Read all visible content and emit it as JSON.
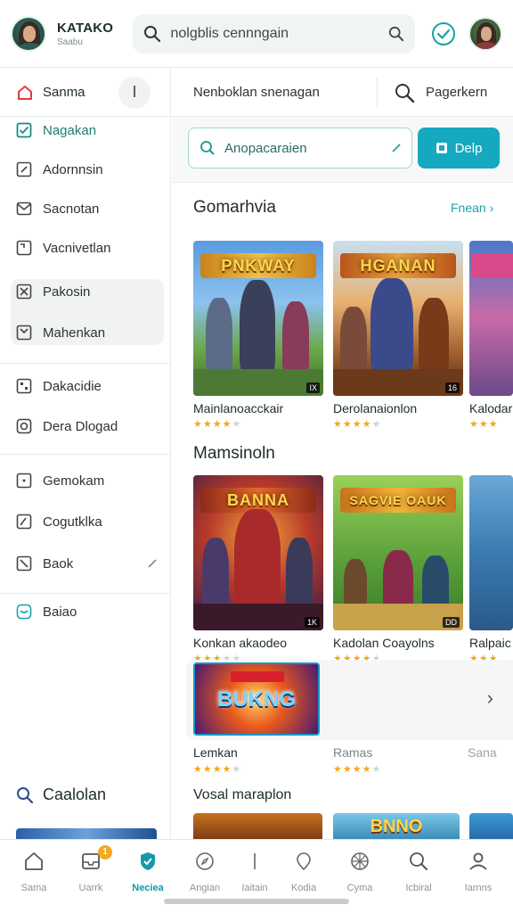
{
  "header": {
    "app_name": "KATAKO",
    "app_subtitle": "Saabu",
    "search_placeholder": "nolgblis cennngain"
  },
  "sidebar": {
    "top_label": "Sanma",
    "top_button": "I",
    "items": [
      {
        "label": "Nagakan",
        "icon": "check-square-icon",
        "active": true
      },
      {
        "label": "Adornnsin",
        "icon": "edit-square-icon"
      },
      {
        "label": "Sacnotan",
        "icon": "mail-icon"
      },
      {
        "label": "Vacnivetlan",
        "icon": "page-corner-icon"
      },
      {
        "label": "Pakosin",
        "icon": "close-square-icon"
      },
      {
        "label": "Mahenkan",
        "icon": "page-corner-icon"
      },
      {
        "label": "Dakacidie",
        "icon": "grid-square-icon"
      },
      {
        "label": "Dera Dlogad",
        "icon": "circle-square-icon"
      },
      {
        "label": "Gemokam",
        "icon": "dot-square-icon"
      },
      {
        "label": "Cogutklka",
        "icon": "page-corner-icon"
      },
      {
        "label": "Baok",
        "icon": "close-square-icon"
      },
      {
        "label": "Baiao",
        "icon": "chat-square-icon"
      }
    ],
    "bottom_label": "Caalolan"
  },
  "subheader": {
    "title": "Nenboklan snenagan",
    "profile_label": "Pagerkern"
  },
  "filter": {
    "value": "Anopacaraien",
    "button_label": "Delp"
  },
  "sections": [
    {
      "title": "Gomarhvia",
      "link": "Fnean",
      "cards": [
        {
          "name": "Mainlanoacckair",
          "banner": "PNKWAY",
          "tag": "IX",
          "rating": 4
        },
        {
          "name": "Derolanaionlon",
          "banner": "HGANAN",
          "tag": "16",
          "rating": 4
        },
        {
          "name": "Kalodar",
          "banner": "",
          "tag": "",
          "rating": 3
        }
      ]
    },
    {
      "title": "Mamsinoln",
      "cards": [
        {
          "name": "Konkan akaodeo",
          "banner": "BANNA",
          "tag": "1K",
          "rating": 3
        },
        {
          "name": "Kadolan Coayolns",
          "banner": "SAGVIE OAUK",
          "tag": "DD",
          "rating": 4
        },
        {
          "name": "Ralpaic",
          "banner": "",
          "tag": "",
          "rating": 3
        }
      ]
    }
  ],
  "featured": {
    "banner": "BUKNG",
    "labels": [
      "Lemkan",
      "Ramas",
      "Sana"
    ],
    "ratings": [
      4,
      4,
      0
    ]
  },
  "next_section": {
    "title": "Vosal maraplon",
    "peek_banners": [
      "",
      "BNNO",
      ""
    ]
  },
  "bottom_nav": [
    {
      "label": "Sama",
      "icon": "home-icon"
    },
    {
      "label": "Uarrk",
      "icon": "inbox-icon",
      "badge": "1"
    },
    {
      "label": "Neciea",
      "icon": "shield-icon",
      "active": true
    },
    {
      "label": "Angian",
      "icon": "compass-icon"
    },
    {
      "label": "Iaitain",
      "icon": "bar-icon"
    },
    {
      "label": "Kodia",
      "icon": "pin-icon"
    },
    {
      "label": "Cyma",
      "icon": "globe-icon"
    },
    {
      "label": "Icbiral",
      "icon": "search-icon"
    },
    {
      "label": "Iarnns",
      "icon": "user-icon"
    }
  ],
  "colors": {
    "accent": "#15a9c0",
    "active_text": "#1e7a72",
    "star": "#f2a81c"
  }
}
